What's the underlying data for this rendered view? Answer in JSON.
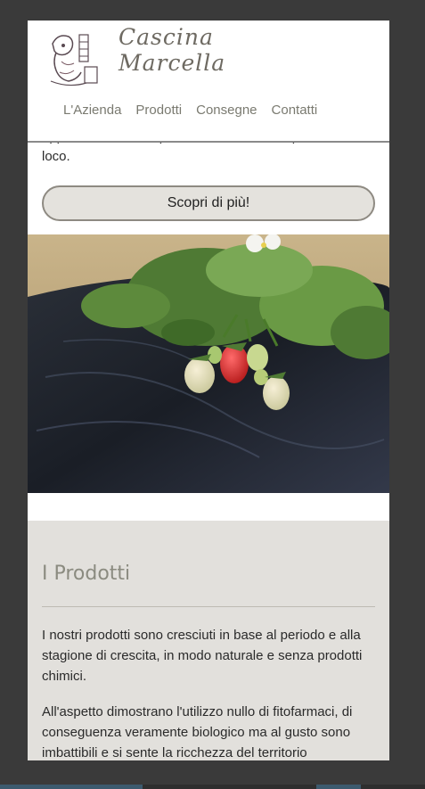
{
  "header": {
    "brand_line1": "Cascina",
    "brand_line2": "Marcella",
    "nav": [
      "L'Azienda",
      "Prodotti",
      "Consegne",
      "Contatti"
    ]
  },
  "intro": {
    "partial_line": "appuntamento, e si possono effettuare acquisti in",
    "last_line": "loco."
  },
  "cta": {
    "label": "Scopri di più!"
  },
  "products": {
    "title": "I Prodotti",
    "p1": "I nostri prodotti sono cresciuti in base al periodo e alla stagione di crescita, in modo naturale e senza prodotti chimici.",
    "p2": "All'aspetto dimostrano l'utilizzo nullo di fitofarmaci, di conseguenza veramente biologico ma al gusto sono imbattibili e si sente la ricchezza del territorio"
  }
}
